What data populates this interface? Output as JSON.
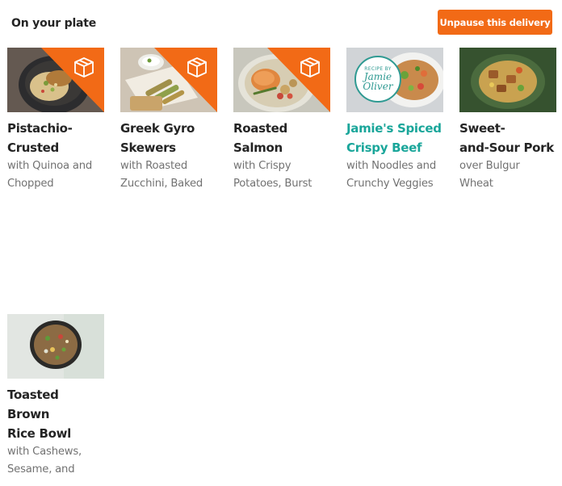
{
  "header": {
    "title": "On your plate",
    "unpause_label": "Unpause this delivery"
  },
  "colors": {
    "accent": "#f26a16",
    "jamie_title": "#1aa69a",
    "subtitle": "#727272"
  },
  "recipes": [
    {
      "name": "Pistachio-\nCrusted",
      "subtitle": "with Quinoa and\nChopped",
      "badge_icon": "box-icon"
    },
    {
      "name": "Greek Gyro\nSkewers",
      "subtitle": "with Roasted\nZucchini, Baked",
      "badge_icon": "box-icon"
    },
    {
      "name": "Roasted\nSalmon",
      "subtitle": "with Crispy\nPotatoes, Burst",
      "badge_icon": "box-icon"
    },
    {
      "name": "Jamie's Spiced\nCrispy Beef",
      "subtitle": "with Noodles and\nCrunchy Veggies",
      "stamp_line1": "RECIPE BY",
      "stamp_line2": "Jamie",
      "stamp_line3": "Oliver"
    },
    {
      "name": "Sweet-\nand-Sour Pork",
      "subtitle": "over Bulgur\nWheat"
    },
    {
      "name": "Toasted Brown\nRice Bowl",
      "subtitle": "with Cashews,\nSesame, and"
    }
  ]
}
